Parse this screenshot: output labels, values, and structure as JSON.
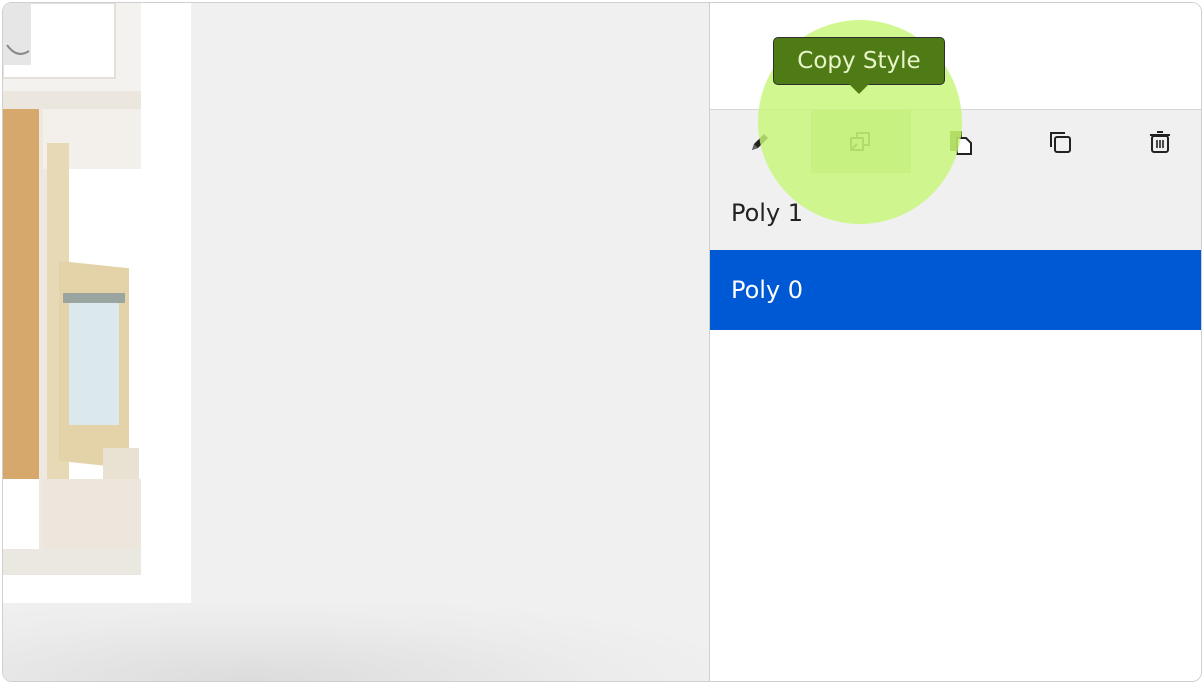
{
  "tooltip": {
    "text": "Copy Style"
  },
  "toolbar": {
    "buttons": [
      {
        "name": "edit",
        "icon": "pencil-icon"
      },
      {
        "name": "copy-style",
        "icon": "copy-style-icon",
        "hovered": true
      },
      {
        "name": "paste-style",
        "icon": "paste-style-icon"
      },
      {
        "name": "duplicate",
        "icon": "duplicate-icon"
      },
      {
        "name": "delete",
        "icon": "trash-icon"
      }
    ]
  },
  "layers": [
    {
      "label": "Poly 1",
      "selected": false
    },
    {
      "label": "Poly 0",
      "selected": true
    }
  ],
  "colors": {
    "selected_row": "#0059d4",
    "highlight": "#c7f578",
    "tooltip_bg": "#4e7b16"
  }
}
